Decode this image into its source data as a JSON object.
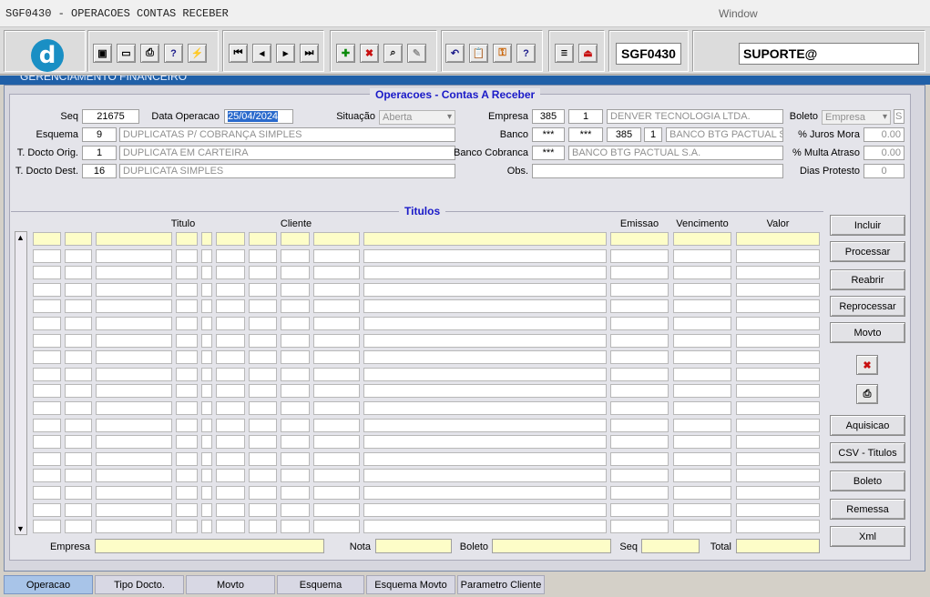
{
  "window": {
    "title": "SGF0430 - OPERACOES CONTAS RECEBER",
    "menu": "Window"
  },
  "toolbar": {
    "screen_code": "SGF0430",
    "user": "SUPORTE@"
  },
  "banner": {
    "text": "GERENCIAMENTO FINANCEIRO"
  },
  "form": {
    "section_title": "Operacoes - Contas A Receber",
    "seq": {
      "label": "Seq",
      "value": "21675"
    },
    "data_operacao": {
      "label": "Data Operacao",
      "value": "25/04/2024"
    },
    "situacao": {
      "label": "Situação",
      "value": "Aberta"
    },
    "empresa": {
      "label": "Empresa",
      "code": "385",
      "sub": "1",
      "name": "DENVER TECNOLOGIA LTDA."
    },
    "boleto": {
      "label": "Boleto",
      "value": "Empresa",
      "flag": "S"
    },
    "esquema": {
      "label": "Esquema",
      "code": "9",
      "name": "DUPLICATAS P/ COBRANÇA SIMPLES"
    },
    "banco": {
      "label": "Banco",
      "a": "***",
      "b": "***",
      "code": "385",
      "sub": "1",
      "name": "BANCO BTG PACTUAL S.A."
    },
    "juros_mora": {
      "label": "% Juros Mora",
      "value": "0.00"
    },
    "docto_orig": {
      "label": "T. Docto Orig.",
      "code": "1",
      "name": "DUPLICATA EM CARTEIRA"
    },
    "banco_cobranca": {
      "label": "Banco Cobranca",
      "code": "***",
      "name": "BANCO BTG PACTUAL S.A."
    },
    "multa_atraso": {
      "label": "% Multa Atraso",
      "value": "0.00"
    },
    "docto_dest": {
      "label": "T. Docto Dest.",
      "code": "16",
      "name": "DUPLICATA SIMPLES"
    },
    "obs": {
      "label": "Obs.",
      "value": ""
    },
    "dias_protesto": {
      "label": "Dias Protesto",
      "value": "0"
    }
  },
  "titulos": {
    "title": "Titulos",
    "headers": {
      "titulo": "Titulo",
      "cliente": "Cliente",
      "emissao": "Emissao",
      "vencimento": "Vencimento",
      "valor": "Valor"
    },
    "footer": {
      "empresa": "Empresa",
      "nota": "Nota",
      "boleto": "Boleto",
      "seq": "Seq",
      "total": "Total"
    }
  },
  "buttons": {
    "incluir": "Incluir",
    "processar": "Processar",
    "reabrir": "Reabrir",
    "reprocessar": "Reprocessar",
    "movto": "Movto",
    "aquisicao": "Aquisicao",
    "csv": "CSV - Titulos",
    "boleto": "Boleto",
    "remessa": "Remessa",
    "xml": "Xml"
  },
  "tabs": [
    "Operacao",
    "Tipo Docto.",
    "Movto",
    "Esquema",
    "Esquema Movto",
    "Parametro Cliente"
  ],
  "colors": {
    "accent": "#1a1ac8",
    "required": "#fdfdc8",
    "active_tab": "#a8c4e8"
  }
}
